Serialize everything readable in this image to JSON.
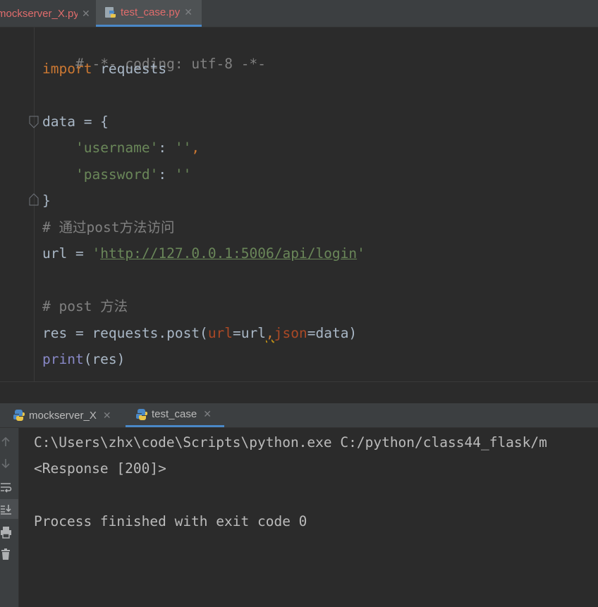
{
  "editor_tabs": [
    {
      "label": "mockserver_X.py",
      "visible_label": "mockserver_X.py"
    },
    {
      "label": "test_case.py"
    }
  ],
  "code": {
    "line1": "# -*- coding: utf-8 -*-",
    "line2_kw": "import",
    "line2_rest": " requests",
    "line4": "data = {",
    "line5_key": "'username'",
    "line5_sep": ": ",
    "line5_val": "''",
    "line5_comma": ",",
    "line6_key": "'password'",
    "line6_sep": ": ",
    "line6_val": "''",
    "line7": "}",
    "line8": "# 通过post方法访问",
    "line9_prefix": "url = ",
    "line9_q1": "'",
    "line9_url": "http://127.0.0.1:5006/api/login",
    "line9_q2": "'",
    "line11": "# post 方法",
    "line12_a": "res = requests.post(",
    "line12_p1": "url",
    "line12_b": "=url",
    "line12_c": ",",
    "line12_p2": "json",
    "line12_d": "=data)",
    "line13_fn": "print",
    "line13_rest": "(res)"
  },
  "run_tabs": [
    {
      "label": "mockserver_X"
    },
    {
      "label": "test_case"
    }
  ],
  "console": {
    "line1": "C:\\Users\\zhx\\code\\Scripts\\python.exe C:/python/class44_flask/m",
    "line2": "<Response [200]>",
    "line4": "Process finished with exit code 0"
  },
  "icons": [
    "python-file-icon",
    "close-icon",
    "arrow-up-icon",
    "arrow-down-icon",
    "soft-wrap-icon",
    "scroll-to-end-icon",
    "print-icon",
    "trash-icon",
    "fold-icon"
  ],
  "colors": {
    "keyword": "#cc7832",
    "string": "#6a8759",
    "comment": "#808080",
    "param": "#aa4926",
    "builtin": "#8888c6",
    "tab_text_error": "#e06c6c"
  }
}
